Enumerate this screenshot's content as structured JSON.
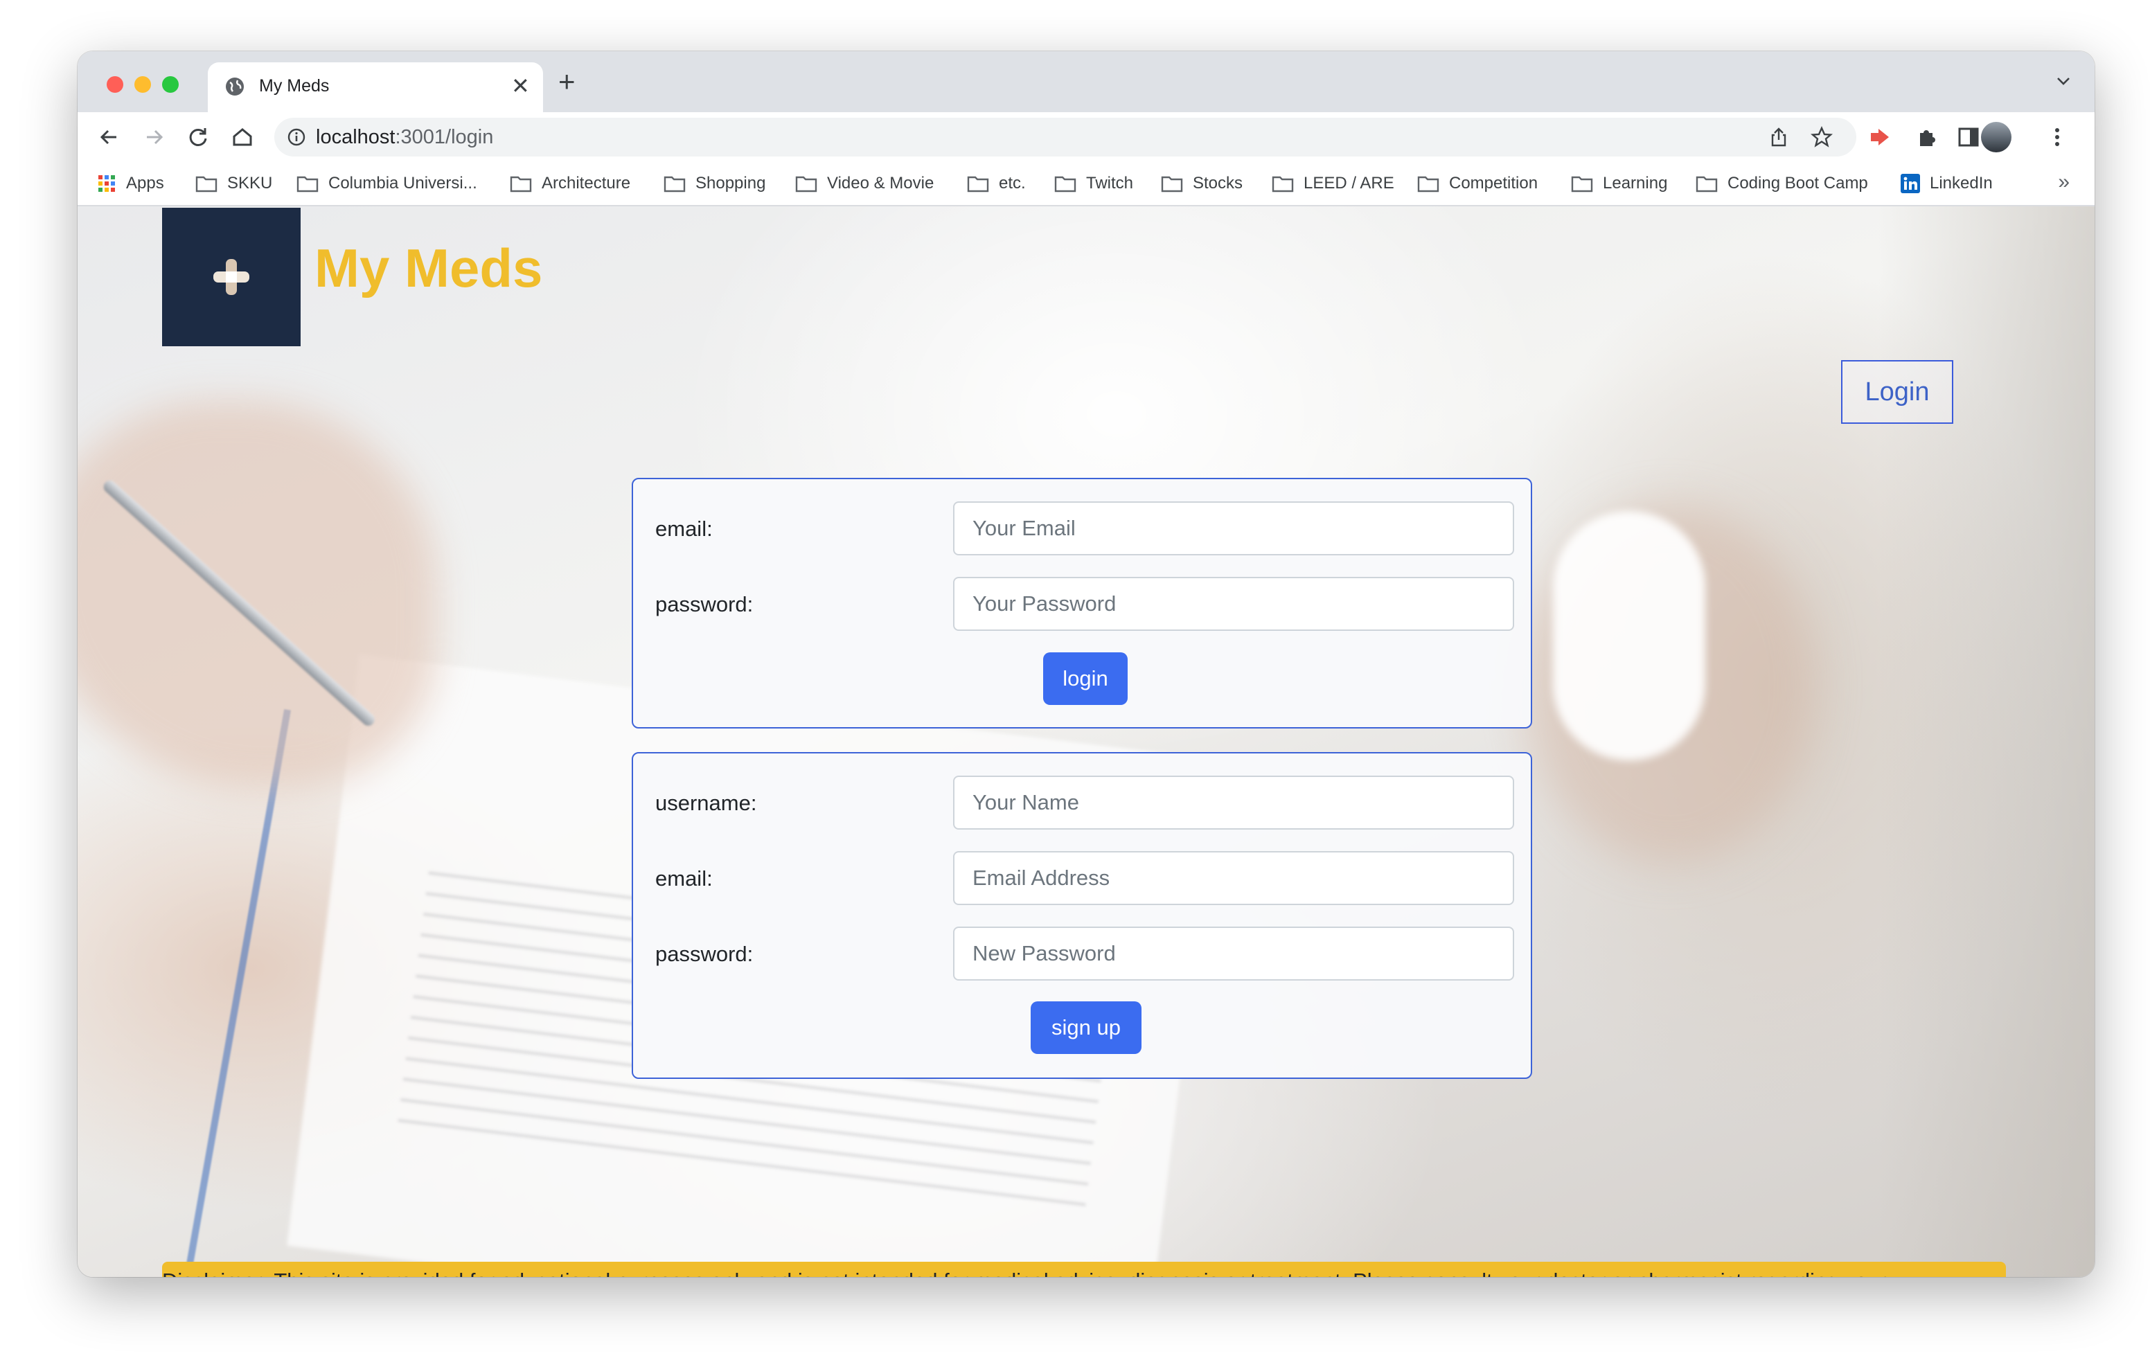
{
  "browser": {
    "tab_title": "My Meds",
    "url_host": "localhost",
    "url_path": ":3001/login",
    "bookmarks": [
      {
        "label": "Apps",
        "icon": "apps-grid-icon"
      },
      {
        "label": "SKKU",
        "icon": "folder-icon"
      },
      {
        "label": "Columbia Universi...",
        "icon": "folder-icon"
      },
      {
        "label": "Architecture",
        "icon": "folder-icon"
      },
      {
        "label": "Shopping",
        "icon": "folder-icon"
      },
      {
        "label": "Video & Movie",
        "icon": "folder-icon"
      },
      {
        "label": "etc.",
        "icon": "folder-icon"
      },
      {
        "label": "Twitch",
        "icon": "folder-icon"
      },
      {
        "label": "Stocks",
        "icon": "folder-icon"
      },
      {
        "label": "LEED / ARE",
        "icon": "folder-icon"
      },
      {
        "label": "Competition",
        "icon": "folder-icon"
      },
      {
        "label": "Learning",
        "icon": "folder-icon"
      },
      {
        "label": "Coding Boot Camp",
        "icon": "folder-icon"
      },
      {
        "label": "LinkedIn",
        "icon": "linkedin-icon"
      }
    ],
    "bookmarks_overflow": "»"
  },
  "header": {
    "site_title": "My Meds",
    "nav_login": "Login"
  },
  "login_form": {
    "email_label": "email:",
    "email_placeholder": "Your Email",
    "password_label": "password:",
    "password_placeholder": "Your Password",
    "submit_label": "login"
  },
  "signup_form": {
    "username_label": "username:",
    "username_placeholder": "Your Name",
    "email_label": "email:",
    "email_placeholder": "Email Address",
    "password_label": "password:",
    "password_placeholder": "New Password",
    "submit_label": "sign up"
  },
  "disclaimer": "Disclaimer: This site is provided for educational purposes only and is not intended for medical advice, diagnosis or treatment. Please consult your doctor or pharmacist regarding your medications.",
  "colors": {
    "brand_yellow": "#f0bd2c",
    "logo_navy": "#1c2b44",
    "primary_blue": "#3b6cf0",
    "card_border": "#3d63d8"
  }
}
